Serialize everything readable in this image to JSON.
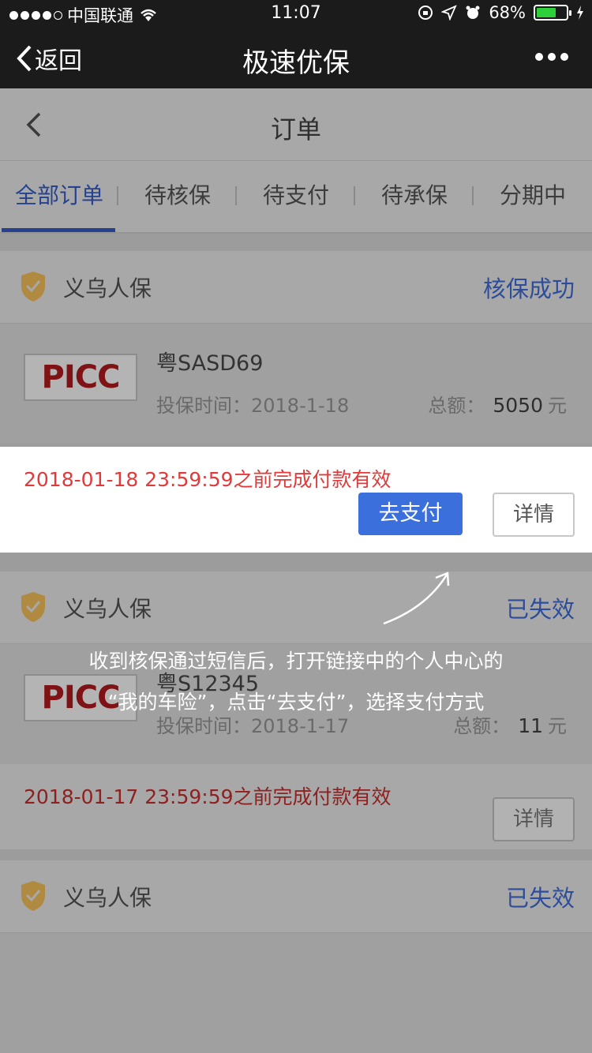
{
  "status_bar": {
    "carrier": "中国联通",
    "time": "11:07",
    "battery": "68%",
    "battery_level": 0.68
  },
  "wechat_nav": {
    "back_label": "返回",
    "title": "极速优保"
  },
  "page": {
    "title": "订单"
  },
  "tabs": [
    {
      "label": "全部订单",
      "active": true
    },
    {
      "label": "待核保"
    },
    {
      "label": "待支付"
    },
    {
      "label": "待承保"
    },
    {
      "label": "分期中"
    }
  ],
  "orders": [
    {
      "company": "义乌人保",
      "status": "核保成功",
      "logo_text": "PICC",
      "plate": "粤SASD69",
      "time_label": "投保时间：",
      "time": "2018-1-18",
      "total_label": "总额：",
      "total": "5050",
      "currency": "元",
      "deadline": "2018-01-18 23:59:59之前完成付款有效",
      "pay_label": "去支付",
      "detail_label": "详情"
    },
    {
      "company": "义乌人保",
      "status": "已失效",
      "logo_text": "PICC",
      "plate": "粤S12345",
      "time_label": "投保时间：",
      "time": "2018-1-17",
      "total_label": "总额：",
      "total": "11",
      "currency": "元",
      "deadline": "2018-01-17 23:59:59之前完成付款有效",
      "detail_label": "详情"
    },
    {
      "company": "义乌人保",
      "status": "已失效"
    }
  ],
  "annotation": {
    "line1": "收到核保通过短信后，打开链接中的个人中心的",
    "line2": "“我的车险”，点击“去支付”，选择支付方式"
  },
  "colors": {
    "accent_blue": "#3a6fdc",
    "deadline_red": "#e03a3a",
    "shield_gold": "#e2a93a"
  }
}
